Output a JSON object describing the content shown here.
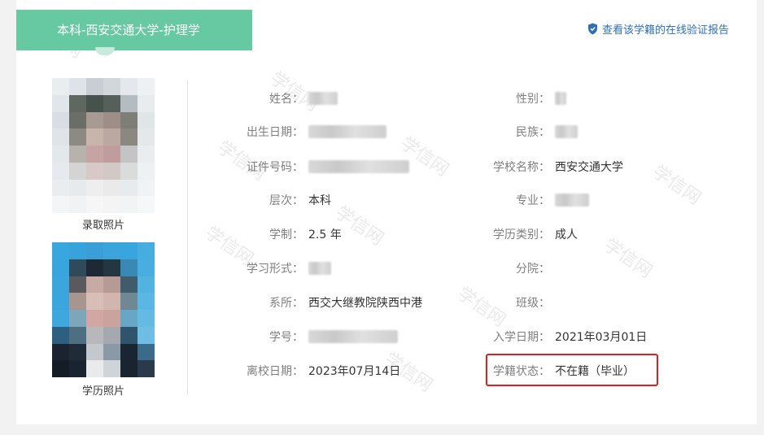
{
  "header": {
    "tab_title": "本科-西安交通大学-护理学",
    "verify_link_label": "查看该学籍的在线验证报告",
    "verify_icon": "shield-check-icon"
  },
  "photos": {
    "admission_caption": "录取照片",
    "degree_caption": "学历照片"
  },
  "fields": {
    "name_label": "姓名：",
    "gender_label": "性别：",
    "birth_label": "出生日期：",
    "ethnicity_label": "民族：",
    "id_label": "证件号码：",
    "school_label": "学校名称：",
    "school_value": "西安交通大学",
    "level_label": "层次：",
    "level_value": "本科",
    "major_label": "专业：",
    "duration_label": "学制：",
    "duration_value": "2.5 年",
    "category_label": "学历类别：",
    "category_value": "成人",
    "form_label": "学习形式：",
    "branch_label": "分院：",
    "dept_label": "系所：",
    "dept_value": "西交大继教院陕西中港",
    "class_label": "班级：",
    "student_no_label": "学号：",
    "enroll_label": "入学日期：",
    "enroll_value": "2021年03月01日",
    "leave_label": "离校日期：",
    "leave_value": "2023年07月14日",
    "status_label": "学籍状态：",
    "status_value": "不在籍（毕业）"
  },
  "watermark_text": "学信网",
  "colors": {
    "tab_green": "#66c9a1",
    "link_blue": "#2f6fb8",
    "highlight_red": "#e02020"
  }
}
